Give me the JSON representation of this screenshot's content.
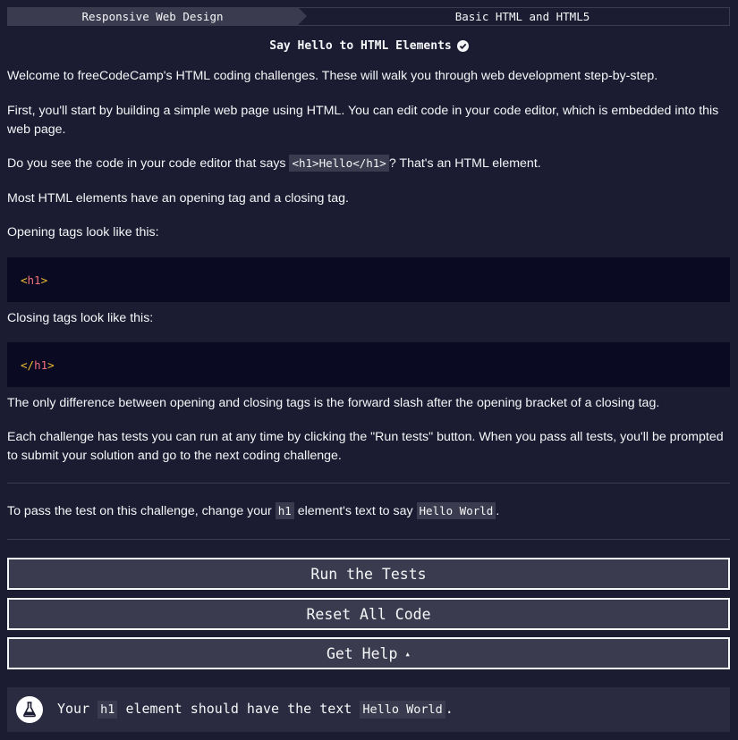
{
  "breadcrumb": {
    "superblock": "Responsive Web Design",
    "block": "Basic HTML and HTML5"
  },
  "challenge": {
    "title": "Say Hello to HTML Elements"
  },
  "description": {
    "p1": "Welcome to freeCodeCamp's HTML coding challenges. These will walk you through web development step-by-step.",
    "p2": "First, you'll start by building a simple web page using HTML. You can edit code in your code editor, which is embedded into this web page.",
    "p3_before": "Do you see the code in your code editor that says ",
    "p3_code": "<h1>Hello</h1>",
    "p3_after": "? That's an HTML element.",
    "p4": "Most HTML elements have an opening tag and a closing tag.",
    "p5": "Opening tags look like this:",
    "code1_open": "<",
    "code1_tag": "h1",
    "code1_close": ">",
    "p6": "Closing tags look like this:",
    "code2_open": "</",
    "code2_tag": "h1",
    "code2_close": ">",
    "p7": "The only difference between opening and closing tags is the forward slash after the opening bracket of a closing tag.",
    "p8": "Each challenge has tests you can run at any time by clicking the \"Run tests\" button. When you pass all tests, you'll be prompted to submit your solution and go to the next coding challenge."
  },
  "instructions": {
    "before": "To pass the test on this challenge, change your ",
    "code1": "h1",
    "middle": " element's text to say ",
    "code2": "Hello World",
    "after": "."
  },
  "buttons": {
    "run": "Run the Tests",
    "reset": "Reset All Code",
    "help": "Get Help",
    "help_caret": "▴"
  },
  "test": {
    "icon": "flask-icon",
    "before": "Your ",
    "code1": "h1",
    "middle": " element should have the text ",
    "code2": "Hello World",
    "after": "."
  },
  "colors": {
    "background": "#1b1b32",
    "panel": "#3b3b4f",
    "code_bg": "#0a0a23",
    "text": "#f5f6f7"
  }
}
